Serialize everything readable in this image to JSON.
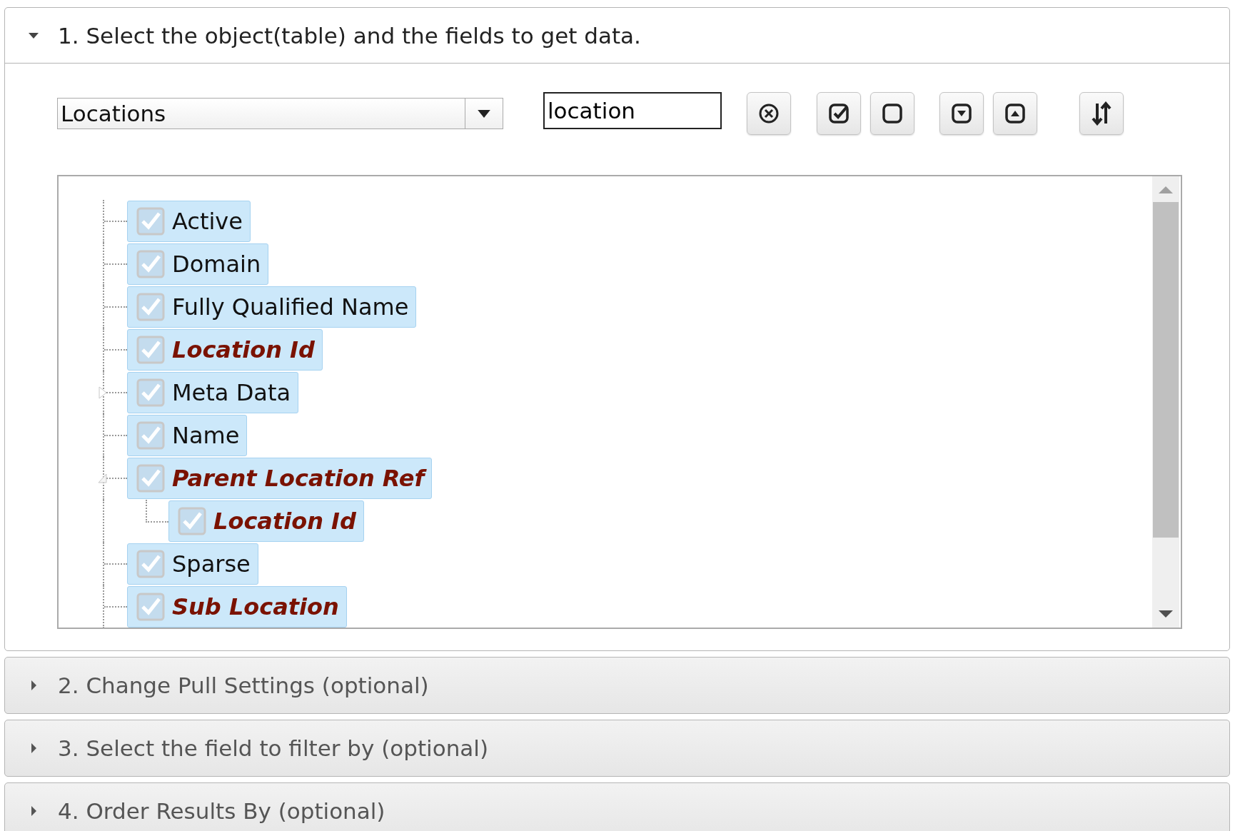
{
  "sections": [
    {
      "title": "1. Select the object(table) and the fields to get data.",
      "expanded": true
    },
    {
      "title": "2. Change Pull Settings (optional)",
      "expanded": false
    },
    {
      "title": "3. Select the field to filter by (optional)",
      "expanded": false
    },
    {
      "title": "4. Order Results By (optional)",
      "expanded": false
    }
  ],
  "object_select": {
    "value": "Locations"
  },
  "search": {
    "value": "location"
  },
  "fields": [
    {
      "label": "Active",
      "checked": true,
      "highlighted": false
    },
    {
      "label": "Domain",
      "checked": true,
      "highlighted": false
    },
    {
      "label": "Fully Qualified Name",
      "checked": true,
      "highlighted": false
    },
    {
      "label": "Location Id",
      "checked": true,
      "highlighted": true
    },
    {
      "label": "Meta Data",
      "checked": true,
      "highlighted": false,
      "expanded": false
    },
    {
      "label": "Name",
      "checked": true,
      "highlighted": false
    },
    {
      "label": "Parent Location Ref",
      "checked": true,
      "highlighted": true,
      "expanded": true,
      "children": [
        {
          "label": "Location Id",
          "checked": true,
          "highlighted": true
        }
      ]
    },
    {
      "label": "Sparse",
      "checked": true,
      "highlighted": false
    },
    {
      "label": "Sub Location",
      "checked": true,
      "highlighted": true
    }
  ]
}
